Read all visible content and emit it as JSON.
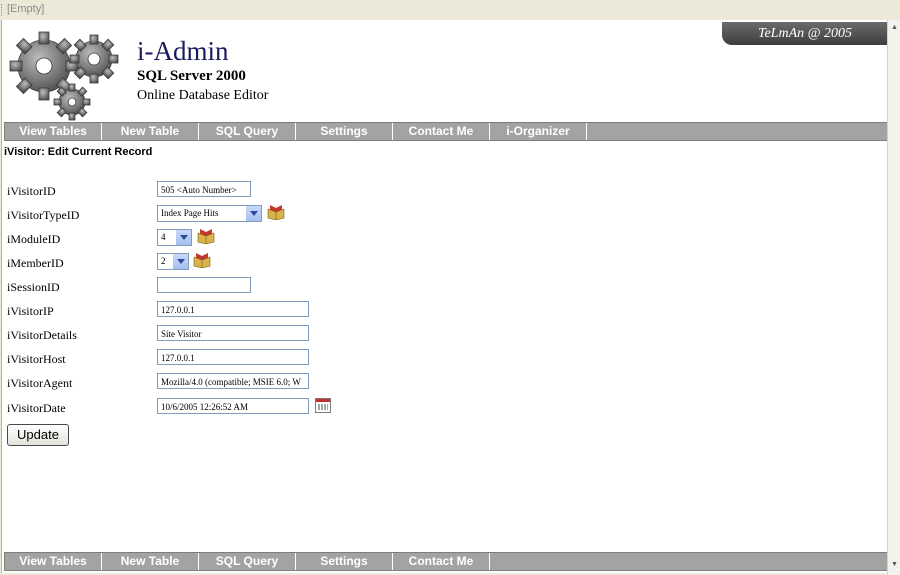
{
  "window": {
    "title": "[Empty]"
  },
  "header": {
    "app_name": "i-Admin",
    "subtitle1": "SQL Server 2000",
    "subtitle2": "Online Database Editor",
    "badge": "TeLmAn @ 2005"
  },
  "nav_top": [
    "View Tables",
    "New Table",
    "SQL Query",
    "Settings",
    "Contact Me",
    "i-Organizer"
  ],
  "nav_bottom": [
    "View Tables",
    "New Table",
    "SQL Query",
    "Settings",
    "Contact Me"
  ],
  "page_title": "iVisitor: Edit Current Record",
  "form": {
    "iVisitorID": {
      "label": "iVisitorID",
      "value": "505 <Auto Number>"
    },
    "iVisitorTypeID": {
      "label": "iVisitorTypeID",
      "value": "Index Page Hits"
    },
    "iModuleID": {
      "label": "iModuleID",
      "value": "4"
    },
    "iMemberID": {
      "label": "iMemberID",
      "value": "2"
    },
    "iSessionID": {
      "label": "iSessionID",
      "value": ""
    },
    "iVisitorIP": {
      "label": "iVisitorIP",
      "value": "127.0.0.1"
    },
    "iVisitorDetails": {
      "label": "iVisitorDetails",
      "value": "Site Visitor"
    },
    "iVisitorHost": {
      "label": "iVisitorHost",
      "value": "127.0.0.1"
    },
    "iVisitorAgent": {
      "label": "iVisitorAgent",
      "value": "Mozilla/4.0 (compatible; MSIE 6.0; W"
    },
    "iVisitorDate": {
      "label": "iVisitorDate",
      "value": "10/6/2005 12:26:52 AM"
    }
  },
  "update_button": "Update",
  "colors": {
    "nav_bg": "#a3a3a3",
    "brand": "#1a1a5e",
    "input_border": "#7f9db9"
  }
}
